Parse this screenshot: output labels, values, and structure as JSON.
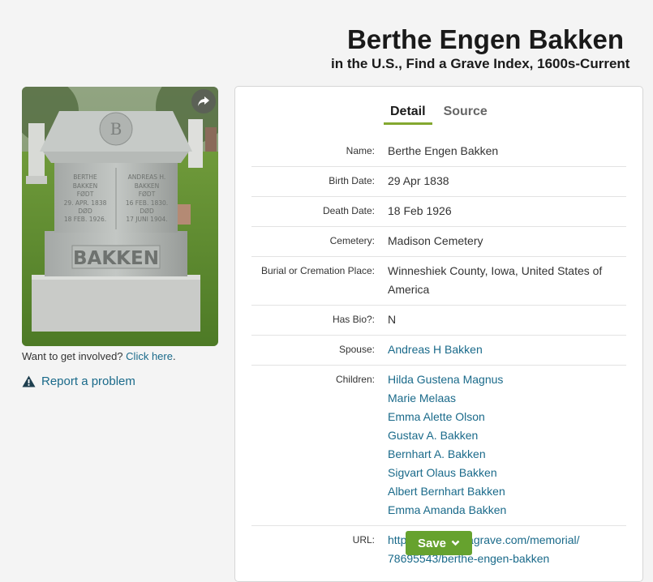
{
  "header": {
    "title": "Berthe Engen Bakken",
    "subtitle": "in the U.S., Find a Grave Index, 1600s-Current"
  },
  "photo": {
    "stone_text_main": "BAKKEN",
    "stone_left": [
      "BERTHE",
      "BAKKEN",
      "FØDT",
      "29. APR. 1838",
      "DØD",
      "18 FEB. 1926."
    ],
    "stone_right": [
      "ANDREAS H.",
      "BAKKEN",
      "FØDT",
      "16 FEB. 1830.",
      "DØD",
      "17 JUNI 1904."
    ],
    "share_icon": "share-icon"
  },
  "involve": {
    "prefix": "Want to get involved?",
    "link": "Click here",
    "suffix": "."
  },
  "report": {
    "label": "Report a problem",
    "icon": "warning-icon"
  },
  "tabs": {
    "detail": "Detail",
    "source": "Source"
  },
  "fields": {
    "name": {
      "label": "Name:",
      "value": "Berthe Engen Bakken"
    },
    "birth": {
      "label": "Birth Date:",
      "value": "29 Apr 1838"
    },
    "death": {
      "label": "Death Date:",
      "value": "18 Feb 1926"
    },
    "cemetery": {
      "label": "Cemetery:",
      "value": "Madison Cemetery"
    },
    "burial": {
      "label": "Burial or Cremation Place:",
      "value": "Winneshiek County, Iowa, United States of America"
    },
    "bio": {
      "label": "Has Bio?:",
      "value": "N"
    },
    "spouse": {
      "label": "Spouse:",
      "value": "Andreas H Bakken"
    },
    "children": {
      "label": "Children:",
      "items": [
        "Hilda Gustena Magnus",
        "Marie Melaas",
        "Emma Alette Olson",
        "Gustav A. Bakken",
        "Bernhart A. Bakken",
        "Sigvart Olaus Bakken",
        "Albert Bernhart Bakken",
        "Emma Amanda Bakken"
      ]
    },
    "url": {
      "label": "URL:",
      "line1": "https://www.findagrave.com/memorial/",
      "line2": "78695543/berthe-engen-bakken"
    }
  },
  "save": {
    "label": "Save",
    "icon": "chevron-down-icon"
  },
  "colors": {
    "accent": "#84a830",
    "link": "#1a6a8a",
    "save": "#66a22e"
  }
}
